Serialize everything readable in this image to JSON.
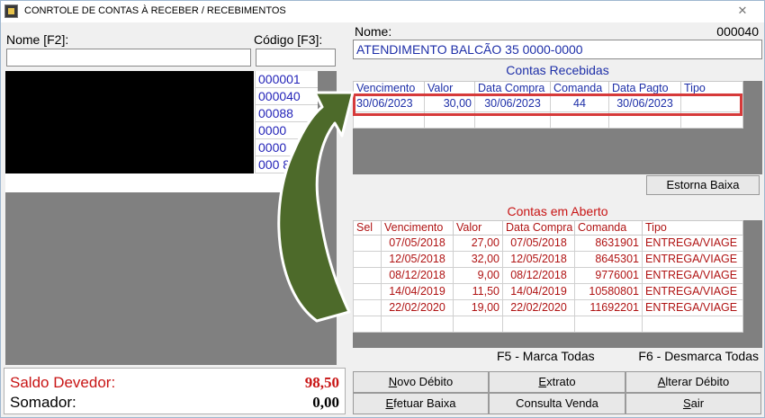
{
  "window": {
    "title": "CONRTOLE DE CONTAS À RECEBER / RECEBIMENTOS",
    "close_symbol": "✕"
  },
  "left": {
    "name_label": "Nome [F2]:",
    "code_label": "Código [F3]:",
    "codes": [
      "000001",
      "000040",
      "00088",
      "0000",
      "0000",
      "000  8"
    ]
  },
  "right": {
    "name_label": "Nome:",
    "client_code": "000040",
    "name_value": "ATENDIMENTO BALCÃO 35 0000-0000",
    "received_title": "Contas Recebidas",
    "received_headers": [
      "Vencimento",
      "Valor",
      "Data Compra",
      "Comanda",
      "Data Pagto",
      "Tipo"
    ],
    "received_rows": [
      [
        "30/06/2023",
        "30,00",
        "30/06/2023",
        "44",
        "30/06/2023",
        ""
      ]
    ],
    "estorna_label": "Estorna Baixa",
    "open_title": "Contas em Aberto",
    "open_headers": [
      "Sel",
      "Vencimento",
      "Valor",
      "Data Compra",
      "Comanda",
      "Tipo"
    ],
    "open_rows": [
      [
        "",
        "07/05/2018",
        "27,00",
        "07/05/2018",
        "8631901",
        "ENTREGA/VIAGE"
      ],
      [
        "",
        "12/05/2018",
        "32,00",
        "12/05/2018",
        "8645301",
        "ENTREGA/VIAGE"
      ],
      [
        "",
        "08/12/2018",
        "9,00",
        "08/12/2018",
        "9776001",
        "ENTREGA/VIAGE"
      ],
      [
        "",
        "14/04/2019",
        "11,50",
        "14/04/2019",
        "10580801",
        "ENTREGA/VIAGE"
      ],
      [
        "",
        "22/02/2020",
        "19,00",
        "22/02/2020",
        "11692201",
        "ENTREGA/VIAGE"
      ]
    ],
    "f5_label": "F5 - Marca Todas",
    "f6_label": "F6 - Desmarca Todas"
  },
  "totals": {
    "saldo_label": "Saldo Devedor:",
    "saldo_value": "98,50",
    "somador_label": "Somador:",
    "somador_value": "0,00"
  },
  "buttons": {
    "novo_debito": {
      "u": "N",
      "rest": "ovo Débito"
    },
    "extrato": {
      "u": "E",
      "rest": "xtrato"
    },
    "alterar_debito": {
      "u": "A",
      "rest": "lterar Débito"
    },
    "efetuar_baixa": {
      "u": "E",
      "rest": "fetuar Baixa"
    },
    "consulta_venda": "Consulta Venda",
    "sair": {
      "u": "S",
      "rest": "air"
    }
  },
  "colors": {
    "received_text": "#1e2fa8",
    "open_text": "#b01414",
    "highlight": "#d63a3a",
    "arrow": "#4d6a2a"
  }
}
